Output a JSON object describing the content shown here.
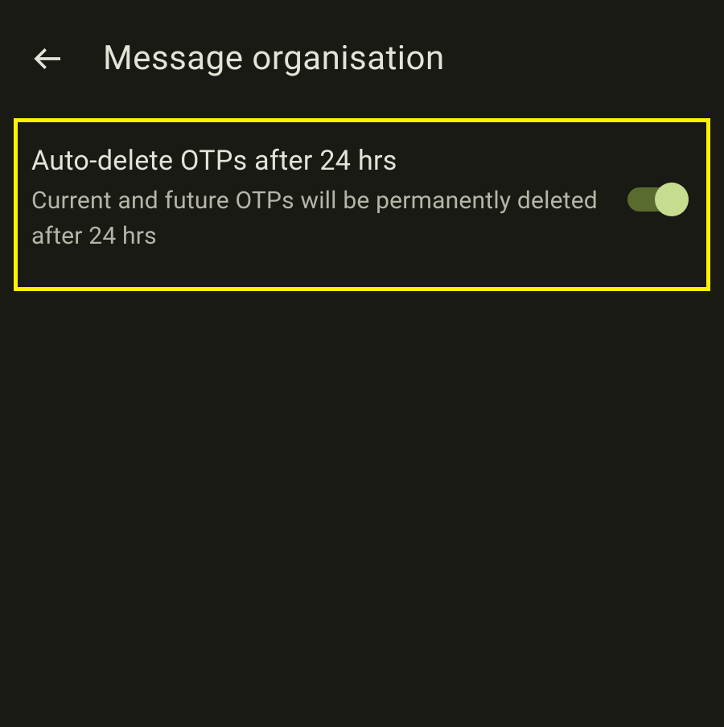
{
  "header": {
    "title": "Message organisation"
  },
  "settings": {
    "autoDeleteOtp": {
      "title": "Auto-delete OTPs after 24 hrs",
      "description": "Current and future OTPs will be permanently deleted after 24 hrs",
      "enabled": true
    }
  }
}
